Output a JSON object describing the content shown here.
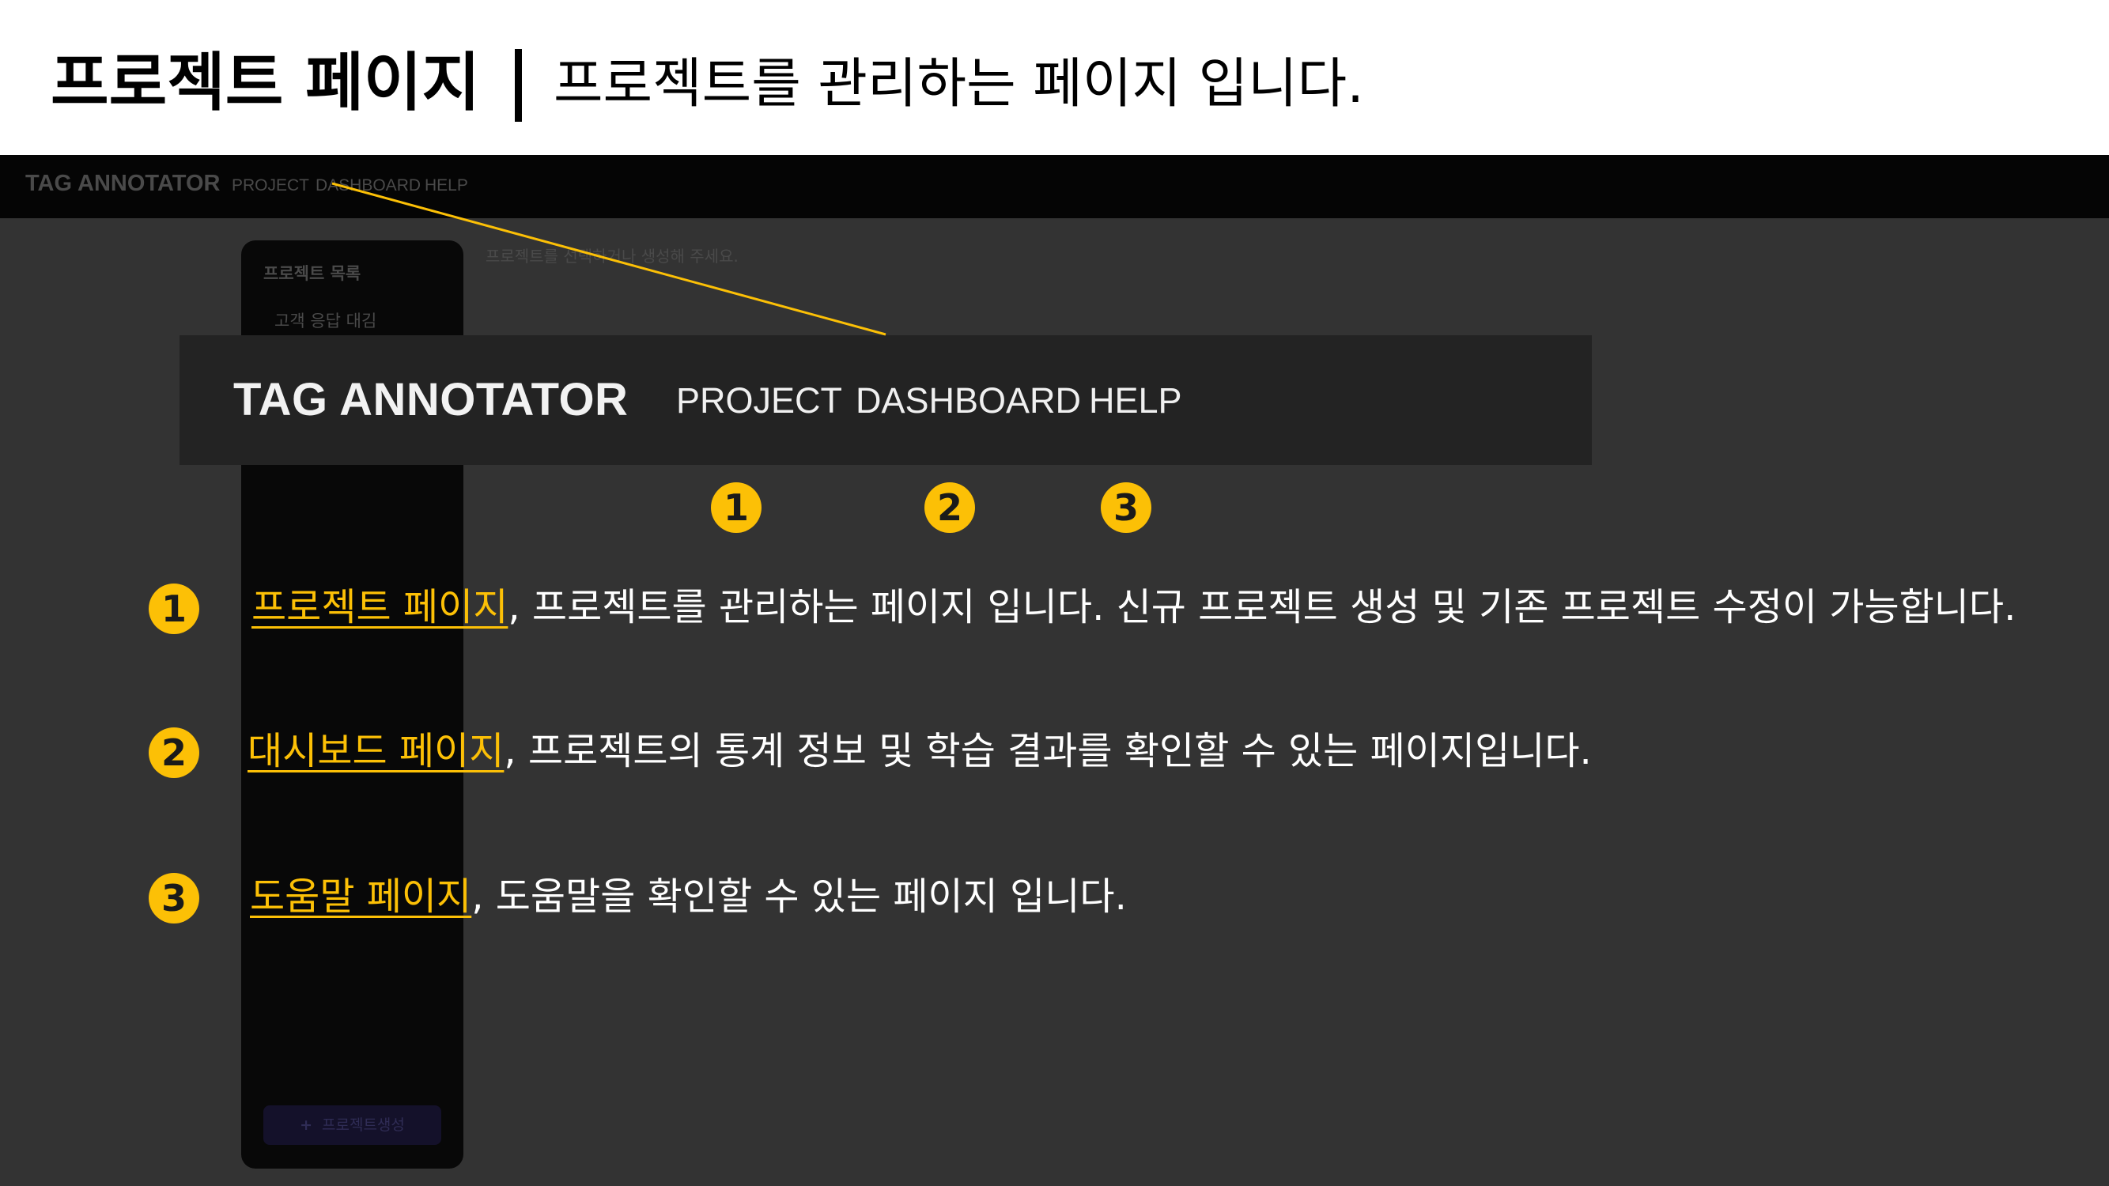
{
  "slide": {
    "title": "프로젝트 페이지",
    "subtitle": "프로젝트를 관리하는 페이지 입니다."
  },
  "app": {
    "brand": "TAG ANNOTATOR",
    "nav": {
      "project": "PROJECT",
      "dashboard": "DASHBOARD",
      "help": "HELP"
    },
    "sidebar": {
      "heading": "프로젝트 목록",
      "items": [
        "고객 응답 대김"
      ],
      "create_plus": "+",
      "create_label": "프로젝트생성"
    },
    "main_hint": "프로젝트를 선택하거나 생성해 주세요."
  },
  "markers": [
    "1",
    "2",
    "3"
  ],
  "descriptions": [
    {
      "marker": "1",
      "link": "프로젝트 페이지",
      "text": ", 프로젝트를 관리하는 페이지 입니다. 신규 프로젝트 생성 및 기존 프로젝트 수정이 가능합니다."
    },
    {
      "marker": "2",
      "link": "대시보드 페이지",
      "text": ", 프로젝트의 통계 정보 및 학습 결과를 확인할 수 있는 페이지입니다."
    },
    {
      "marker": "3",
      "link": "도움말 페이지",
      "text": ", 도움말을 확인할 수 있는 페이지 입니다."
    }
  ],
  "colors": {
    "accent": "#fcc006",
    "background": "#333333",
    "navbar": "#050505",
    "zoom_bar": "#232323"
  }
}
